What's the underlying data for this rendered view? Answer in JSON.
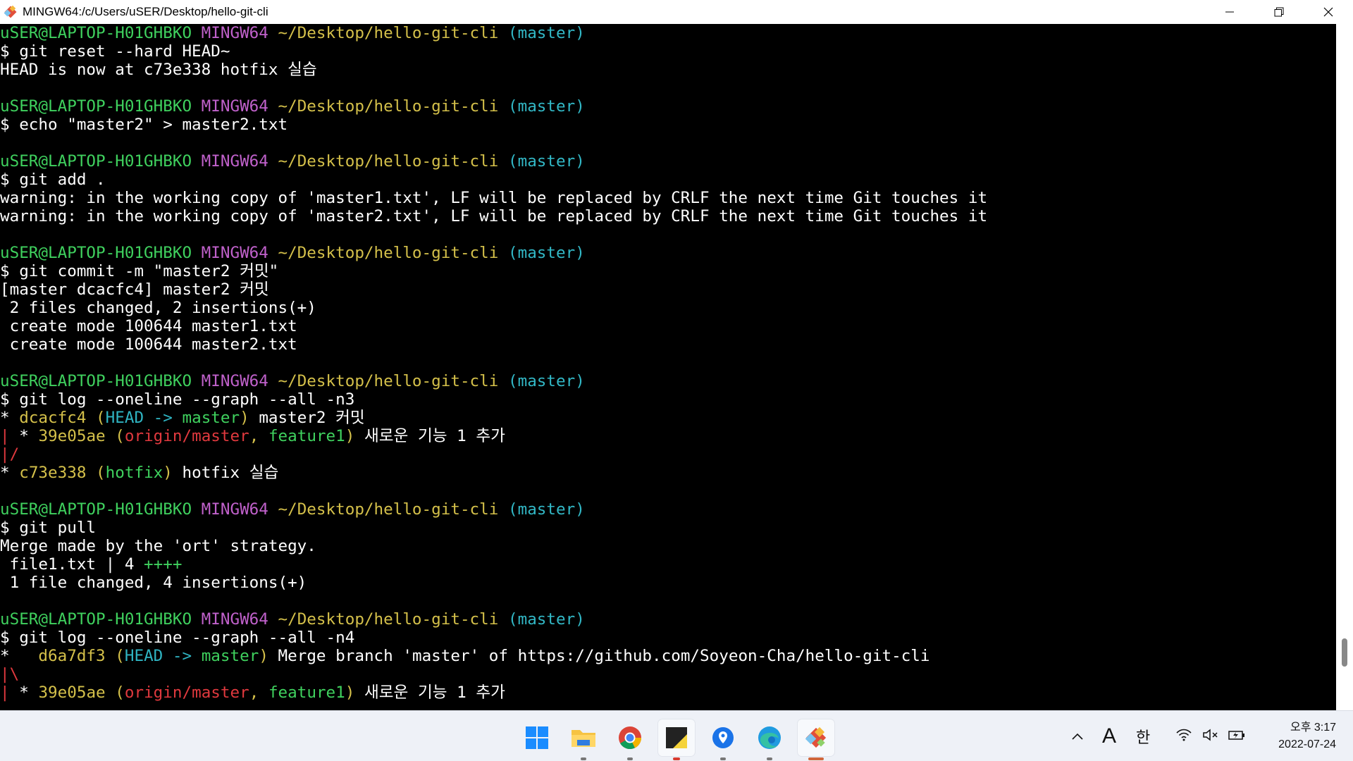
{
  "window": {
    "title": "MINGW64:/c/Users/uSER/Desktop/hello-git-cli",
    "app_icon": "git-icon"
  },
  "prompt": {
    "user": "uSER@LAPTOP-H01GHBKO",
    "shell": "MINGW64",
    "path": "~/Desktop/hello-git-cli",
    "branch": "(master)"
  },
  "terminal": [
    {
      "type": "prompt"
    },
    {
      "type": "text",
      "segs": [
        [
          "w",
          "$ git reset --hard HEAD~"
        ]
      ]
    },
    {
      "type": "text",
      "segs": [
        [
          "w",
          "HEAD is now at c73e338 hotfix 실습"
        ]
      ]
    },
    {
      "type": "blank"
    },
    {
      "type": "prompt"
    },
    {
      "type": "text",
      "segs": [
        [
          "w",
          "$ echo \"master2\" > master2.txt"
        ]
      ]
    },
    {
      "type": "blank"
    },
    {
      "type": "prompt"
    },
    {
      "type": "text",
      "segs": [
        [
          "w",
          "$ git add ."
        ]
      ]
    },
    {
      "type": "text",
      "segs": [
        [
          "w",
          "warning: in the working copy of 'master1.txt', LF will be replaced by CRLF the next time Git touches it"
        ]
      ]
    },
    {
      "type": "text",
      "segs": [
        [
          "w",
          "warning: in the working copy of 'master2.txt', LF will be replaced by CRLF the next time Git touches it"
        ]
      ]
    },
    {
      "type": "blank"
    },
    {
      "type": "prompt"
    },
    {
      "type": "text",
      "segs": [
        [
          "w",
          "$ git commit -m \"master2 커밋\""
        ]
      ]
    },
    {
      "type": "text",
      "segs": [
        [
          "w",
          "[master dcacfc4] master2 커밋"
        ]
      ]
    },
    {
      "type": "text",
      "segs": [
        [
          "w",
          " 2 files changed, 2 insertions(+)"
        ]
      ]
    },
    {
      "type": "text",
      "segs": [
        [
          "w",
          " create mode 100644 master1.txt"
        ]
      ]
    },
    {
      "type": "text",
      "segs": [
        [
          "w",
          " create mode 100644 master2.txt"
        ]
      ]
    },
    {
      "type": "blank"
    },
    {
      "type": "prompt"
    },
    {
      "type": "text",
      "segs": [
        [
          "w",
          "$ git log --oneline --graph --all -n3"
        ]
      ]
    },
    {
      "type": "text",
      "segs": [
        [
          "w",
          "* "
        ],
        [
          "y",
          "dcacfc4 "
        ],
        [
          "y",
          "("
        ],
        [
          "c",
          "HEAD -> "
        ],
        [
          "g",
          "master"
        ],
        [
          "y",
          ")"
        ],
        [
          "w",
          " master2 커밋"
        ]
      ]
    },
    {
      "type": "text",
      "segs": [
        [
          "r",
          "| "
        ],
        [
          "w",
          "* "
        ],
        [
          "y",
          "39e05ae "
        ],
        [
          "y",
          "("
        ],
        [
          "r",
          "origin/master"
        ],
        [
          "y",
          ", "
        ],
        [
          "g",
          "feature1"
        ],
        [
          "y",
          ")"
        ],
        [
          "w",
          " 새로운 기능 1 추가"
        ]
      ]
    },
    {
      "type": "text",
      "segs": [
        [
          "r",
          "|/"
        ]
      ]
    },
    {
      "type": "text",
      "segs": [
        [
          "w",
          "* "
        ],
        [
          "y",
          "c73e338 "
        ],
        [
          "y",
          "("
        ],
        [
          "g",
          "hotfix"
        ],
        [
          "y",
          ")"
        ],
        [
          "w",
          " hotfix 실습"
        ]
      ]
    },
    {
      "type": "blank"
    },
    {
      "type": "prompt"
    },
    {
      "type": "text",
      "segs": [
        [
          "w",
          "$ git pull"
        ]
      ]
    },
    {
      "type": "text",
      "segs": [
        [
          "w",
          "Merge made by the 'ort' strategy."
        ]
      ]
    },
    {
      "type": "text",
      "segs": [
        [
          "w",
          " file1.txt | 4 "
        ],
        [
          "g",
          "++++"
        ]
      ]
    },
    {
      "type": "text",
      "segs": [
        [
          "w",
          " 1 file changed, 4 insertions(+)"
        ]
      ]
    },
    {
      "type": "blank"
    },
    {
      "type": "prompt"
    },
    {
      "type": "text",
      "segs": [
        [
          "w",
          "$ git log --oneline --graph --all -n4"
        ]
      ]
    },
    {
      "type": "text",
      "segs": [
        [
          "w",
          "*   "
        ],
        [
          "y",
          "d6a7df3 "
        ],
        [
          "y",
          "("
        ],
        [
          "c",
          "HEAD -> "
        ],
        [
          "g",
          "master"
        ],
        [
          "y",
          ")"
        ],
        [
          "w",
          " Merge branch 'master' of https://github.com/Soyeon-Cha/hello-git-cli"
        ]
      ]
    },
    {
      "type": "text",
      "segs": [
        [
          "r",
          "|\\"
        ]
      ]
    },
    {
      "type": "text",
      "segs": [
        [
          "r",
          "| "
        ],
        [
          "w",
          "* "
        ],
        [
          "y",
          "39e05ae "
        ],
        [
          "y",
          "("
        ],
        [
          "r",
          "origin/master"
        ],
        [
          "y",
          ", "
        ],
        [
          "g",
          "feature1"
        ],
        [
          "y",
          ")"
        ],
        [
          "w",
          " 새로운 기능 1 추가"
        ]
      ]
    }
  ],
  "taskbar": {
    "apps": [
      {
        "name": "start-icon"
      },
      {
        "name": "file-explorer-icon"
      },
      {
        "name": "chrome-icon"
      },
      {
        "name": "sticky-notes-icon"
      },
      {
        "name": "maps-icon"
      },
      {
        "name": "edge-icon"
      },
      {
        "name": "git-bash-icon"
      }
    ],
    "tray": {
      "chevron": "^",
      "ime_a": "A",
      "ime_lang": "한"
    },
    "clock": {
      "time": "오후 3:17",
      "date": "2022-07-24"
    }
  },
  "colors": {
    "user": "#3fd15e",
    "mingw": "#c061cb",
    "path": "#d4c04a",
    "branch": "#32b8c6",
    "graph_red": "#e0393e"
  }
}
